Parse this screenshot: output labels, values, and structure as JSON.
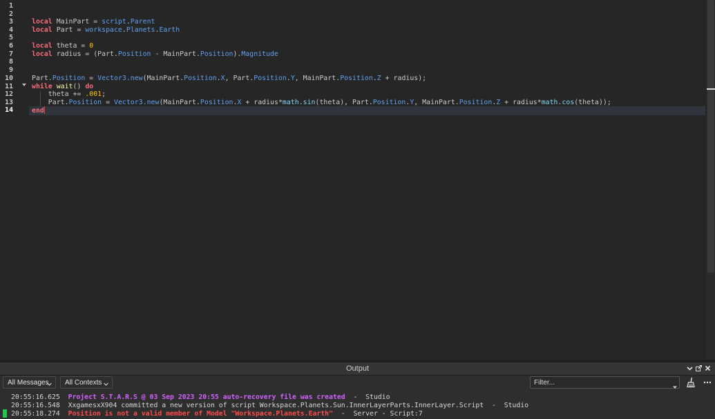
{
  "editor": {
    "line_numbers": [
      "1",
      "2",
      "3",
      "4",
      "5",
      "6",
      "7",
      "8",
      "9",
      "10",
      "11",
      "12",
      "13",
      "14"
    ],
    "current_line": "14",
    "code": {
      "l3": {
        "kw": "local",
        "a": " MainPart = ",
        "b": "script",
        "c": ".",
        "d": "Parent"
      },
      "l4": {
        "kw": "local",
        "a": " Part = ",
        "b": "workspace",
        "c": ".",
        "d": "Planets",
        "e": ".",
        "f": "Earth"
      },
      "l6": {
        "kw": "local",
        "a": " theta = ",
        "num": "0"
      },
      "l7": {
        "kw": "local",
        "a": " radius = (Part.",
        "p1": "Position",
        "b": " - MainPart.",
        "p2": "Position",
        "c": ").",
        "p3": "Magnitude"
      },
      "l10": {
        "a": "Part.",
        "p1": "Position",
        "b": " = ",
        "fn": "Vector3.new",
        "c": "(MainPart.",
        "p2": "Position",
        "d": ".",
        "p3": "X",
        "e": ", Part.",
        "p4": "Position",
        "f": ".",
        "p5": "Y",
        "g": ", MainPart.",
        "p6": "Position",
        "h": ".",
        "p7": "Z",
        "i": " + radius);"
      },
      "l11": {
        "kw1": "while",
        "a": " ",
        "fn": "wait",
        "b": "() ",
        "kw2": "do"
      },
      "l12": {
        "a": "    theta += ",
        "num": ".001",
        "b": ";"
      },
      "l13": {
        "a": "    Part.",
        "p1": "Position",
        "b": " = ",
        "fn1": "Vector3.new",
        "c": "(MainPart.",
        "p2": "Position",
        "d": ".",
        "p3": "X",
        "e": " + radius*",
        "m1": "math.sin",
        "f": "(theta), Part.",
        "p4": "Position",
        "g": ".",
        "p5": "Y",
        "h": ", MainPart.",
        "p6": "Position",
        "i": ".",
        "p7": "Z",
        "j": " + radius*",
        "m2": "math.cos",
        "k": "(theta));"
      },
      "l14": {
        "kw": "end"
      }
    }
  },
  "output": {
    "title": "Output",
    "messages_filter": "All Messages",
    "contexts_filter": "All Contexts",
    "filter_placeholder": "Filter...",
    "log": [
      {
        "time": "20:55:16.625",
        "text": "Project S.T.A.R.S @ 03 Sep 2023 20:55 auto-recovery file was created",
        "source": "  -  Studio",
        "color": "#d262ff"
      },
      {
        "time": "20:55:16.548",
        "text": "XxgamesxX904 committed a new version of script Workspace.Planets.Sun.InnerLayerParts.InnerLayer.Script",
        "source": "  -  Studio",
        "color": "#d6d6d6"
      },
      {
        "time": "20:55:18.274",
        "text": "Position is not a valid member of Model \"Workspace.Planets.Earth\"",
        "source": "  -  Server - Script:7",
        "color": "#ff4c4c"
      }
    ]
  },
  "icons": {
    "fold": "chevron-down-icon",
    "header_buttons": [
      "chevron-down-icon",
      "undock-icon",
      "close-icon"
    ],
    "clear": "broom-icon",
    "more": "more-icon"
  },
  "colors": {
    "keyword": "#f86d7c",
    "property": "#61a1f1",
    "number": "#ffc600",
    "function": "#fdfbac",
    "error": "#ff4c4c",
    "info": "#d262ff",
    "status_green": "#26c350"
  }
}
